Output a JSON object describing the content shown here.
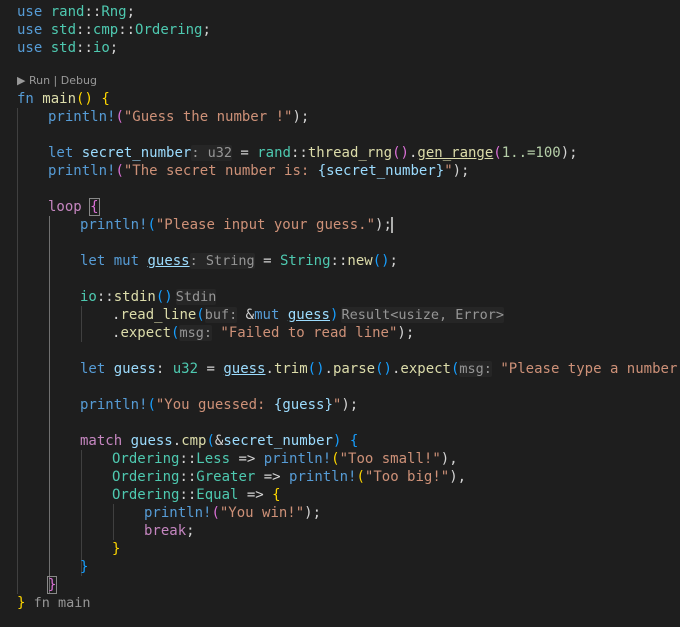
{
  "codelens": {
    "run": "▶ Run",
    "sep": " | ",
    "debug": "Debug"
  },
  "lines": {
    "use1": {
      "kw": "use",
      "path1": "rand",
      "sep": "::",
      "path2": "Rng",
      "end": ";"
    },
    "use2": {
      "kw": "use",
      "path1": "std",
      "sep1": "::",
      "path2": "cmp",
      "sep2": "::",
      "path3": "Ordering",
      "end": ";"
    },
    "use3": {
      "kw": "use",
      "path1": "std",
      "sep": "::",
      "path2": "io",
      "end": ";"
    },
    "fn_main": {
      "kw": "fn",
      "name": "main",
      "paren": "()",
      "brace": "{"
    },
    "println1": {
      "mac": "println!",
      "open": "(",
      "str": "\"Guess the number !\"",
      "close": ");"
    },
    "let_secret": {
      "kw": "let",
      "var": "secret_number",
      "hint": ": u32",
      "eq": " = ",
      "ns": "rand",
      "sep": "::",
      "fn1": "thread_rng",
      "p1": "()",
      "dot": ".",
      "fn2": "gen_range",
      "open": "(",
      "range": "1..=100",
      "close": ");"
    },
    "println2": {
      "mac": "println!",
      "open": "(",
      "str1": "\"The secret number is: ",
      "interp": "{secret_number}",
      "str2": "\"",
      "close": ");"
    },
    "loop": {
      "kw": "loop",
      "brace": "{"
    },
    "println3": {
      "mac": "println!",
      "open": "(",
      "str": "\"Please input your guess.\"",
      "close": ");"
    },
    "let_guess1": {
      "kw": "let",
      "kw2": "mut",
      "var": "guess",
      "hint": ": String",
      "eq": " = ",
      "ty": "String",
      "sep": "::",
      "fn": "new",
      "p": "()",
      "end": ";"
    },
    "stdin": {
      "ns": "io",
      "sep": "::",
      "fn": "stdin",
      "p": "()",
      "hint": "Stdin"
    },
    "read_line": {
      "dot": ".",
      "fn": "read_line",
      "open": "(",
      "hint": "buf:",
      "amp": " &",
      "kw": "mut",
      "var": "guess",
      "close": ")",
      "hint2": "Result<usize, Error>"
    },
    "expect1": {
      "dot": ".",
      "fn": "expect",
      "open": "(",
      "hint": "msg:",
      "str": "\"Failed to read line\"",
      "close": ");"
    },
    "let_guess2": {
      "kw": "let",
      "var": "guess",
      "colon": ": ",
      "ty": "u32",
      "eq": " = ",
      "var2": "guess",
      "dot1": ".",
      "fn1": "trim",
      "p1": "()",
      "dot2": ".",
      "fn2": "parse",
      "p2": "()",
      "dot3": ".",
      "fn3": "expect",
      "open": "(",
      "hint": "msg:",
      "str": "\"Please type a number!\"",
      "close": ");"
    },
    "println4": {
      "mac": "println!",
      "open": "(",
      "str1": "\"You guessed: ",
      "interp": "{guess}",
      "str2": "\"",
      "close": ");"
    },
    "match": {
      "kw": "match",
      "var": "guess",
      "dot": ".",
      "fn": "cmp",
      "open": "(",
      "amp": "&",
      "var2": "secret_number",
      "close": ")",
      "brace": "{"
    },
    "arm_less": {
      "ty": "Ordering",
      "sep": "::",
      "variant": "Less",
      "arrow": " => ",
      "mac": "println!",
      "open": "(",
      "str": "\"Too small!\"",
      "close": "),"
    },
    "arm_greater": {
      "ty": "Ordering",
      "sep": "::",
      "variant": "Greater",
      "arrow": " => ",
      "mac": "println!",
      "open": "(",
      "str": "\"Too big!\"",
      "close": "),"
    },
    "arm_equal": {
      "ty": "Ordering",
      "sep": "::",
      "variant": "Equal",
      "arrow": " => ",
      "brace": "{"
    },
    "println5": {
      "mac": "println!",
      "open": "(",
      "str": "\"You win!\"",
      "close": ");"
    },
    "break": {
      "kw": "break",
      "end": ";"
    },
    "close_equal": {
      "brace": "}"
    },
    "close_match": {
      "brace": "}"
    },
    "close_loop": {
      "brace": "}"
    },
    "close_main": {
      "brace": "}",
      "hint": " fn main"
    }
  }
}
